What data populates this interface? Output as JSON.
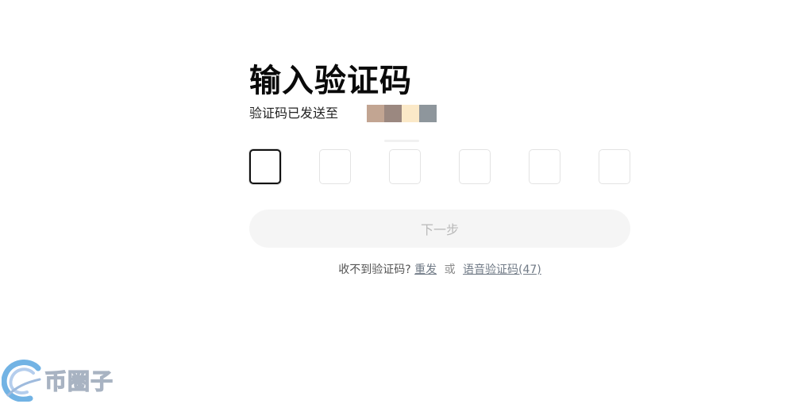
{
  "page": {
    "title": "输入验证码",
    "subtitle": "验证码已发送至"
  },
  "masked_phone": {
    "swatches": [
      "#c2a592",
      "#9b8880",
      "#fbe9c8",
      "#8e969c"
    ]
  },
  "code_input": {
    "length": 6,
    "active_index": 0
  },
  "next_button": {
    "label": "下一步"
  },
  "resend": {
    "prompt": "收不到验证码?",
    "resend_link": "重发",
    "separator": "或",
    "voice_link": "语音验证码",
    "countdown": "(47)"
  },
  "watermark": {
    "text": "币圈子"
  }
}
